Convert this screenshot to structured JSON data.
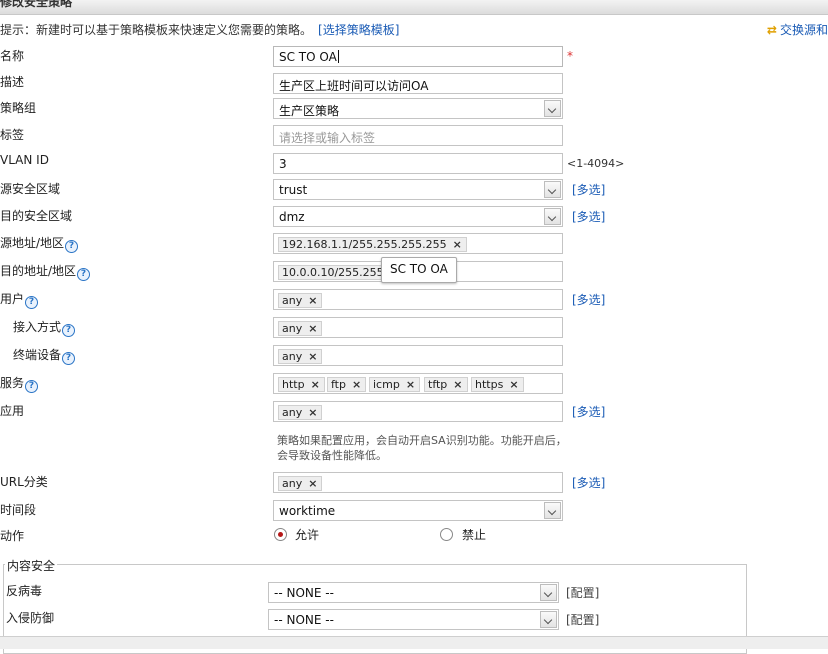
{
  "header": {
    "title": "修改安全策略"
  },
  "hint": {
    "text": "提示：新建时可以基于策略模板来快速定义您需要的策略。",
    "link": "[选择策略模板]"
  },
  "swap_link": "交换源和",
  "form": {
    "name": {
      "label": "名称",
      "value": "SC TO OA",
      "required": "*"
    },
    "desc": {
      "label": "描述",
      "value": "生产区上班时间可以访问OA"
    },
    "group": {
      "label": "策略组",
      "value": "生产区策略"
    },
    "tag": {
      "label": "标签",
      "placeholder": "请选择或输入标签"
    },
    "vlan": {
      "label": "VLAN ID",
      "value": "3",
      "range": "<1-4094>"
    },
    "src_zone": {
      "label": "源安全区域",
      "value": "trust",
      "multi": "[多选]"
    },
    "dst_zone": {
      "label": "目的安全区域",
      "value": "dmz",
      "multi": "[多选]"
    },
    "src_addr": {
      "label": "源地址/地区",
      "tags": [
        "192.168.1.1/255.255.255.255"
      ]
    },
    "dst_addr": {
      "label": "目的地址/地区",
      "tags": [
        "10.0.0.10/255.255."
      ]
    },
    "user": {
      "label": "用户",
      "tags": [
        "any"
      ],
      "multi": "[多选]"
    },
    "access": {
      "label": "接入方式",
      "tags": [
        "any"
      ]
    },
    "terminal": {
      "label": "终端设备",
      "tags": [
        "any"
      ]
    },
    "service": {
      "label": "服务",
      "tags": [
        "http",
        "ftp",
        "icmp",
        "tftp",
        "https"
      ]
    },
    "app": {
      "label": "应用",
      "tags": [
        "any"
      ],
      "multi": "[多选]",
      "note": "策略如果配置应用，会自动开启SA识别功能。功能开启后，会导致设备性能降低。"
    },
    "url": {
      "label": "URL分类",
      "tags": [
        "any"
      ],
      "multi": "[多选]"
    },
    "time": {
      "label": "时间段",
      "value": "worktime"
    },
    "action": {
      "label": "动作",
      "allow": "允许",
      "deny": "禁止",
      "selected": "允许"
    }
  },
  "tooltip": "SC TO OA",
  "content_security": {
    "legend": "内容安全",
    "antivirus": {
      "label": "反病毒",
      "value": "-- NONE --",
      "config": "[配置]"
    },
    "ips": {
      "label": "入侵防御",
      "value": "-- NONE --",
      "config": "[配置]"
    }
  },
  "icons": {
    "help": "question-icon",
    "remove": "close-icon",
    "swap": "swap-icon",
    "dropdown": "chevron-down-icon"
  },
  "colors": {
    "link": "#1a5bb5",
    "required": "#dd3333",
    "radio_selected": "#b51818"
  }
}
